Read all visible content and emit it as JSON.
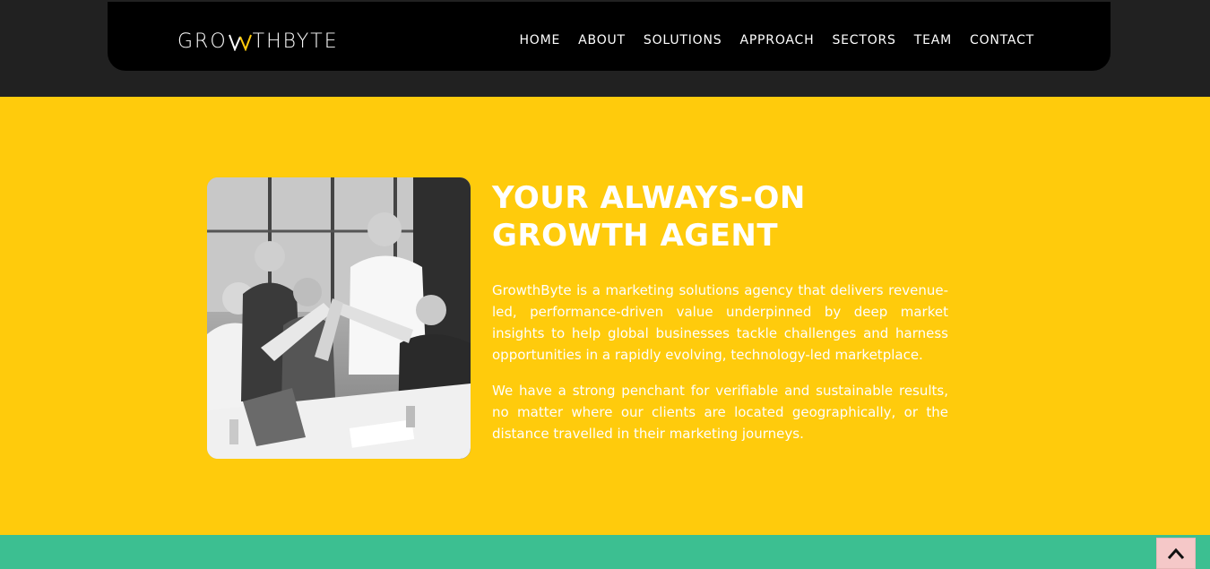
{
  "header": {
    "logo": {
      "before": "GRO",
      "after": "THBYTE",
      "accent_color": "#ffcb0c"
    },
    "nav": [
      "HOME",
      "ABOUT",
      "SOLUTIONS",
      "APPROACH",
      "SECTORS",
      "TEAM",
      "CONTACT"
    ]
  },
  "hero": {
    "title_line1": "YOUR ALWAYS-ON",
    "title_line2": "GROWTH AGENT",
    "paragraph1": "GrowthByte is a marketing solutions agency that delivers revenue-led, performance-driven value underpinned by deep market insights to help global businesses tackle challenges and harness opportunities in a rapidly evolving, technology-led marketplace.",
    "paragraph2": "We have a strong penchant for verifiable and sustainable results, no matter where our clients are located geographically, or the distance travelled in their marketing journeys.",
    "image_icon": "team-high-five-photo"
  },
  "colors": {
    "header_bg": "#000000",
    "band_bg": "#212121",
    "section_bg": "#ffcb0c",
    "next_section_bg": "#3cbf91",
    "scroll_button_bg": "#f5c8c8"
  },
  "scroll_top_icon": "chevron-up-icon"
}
